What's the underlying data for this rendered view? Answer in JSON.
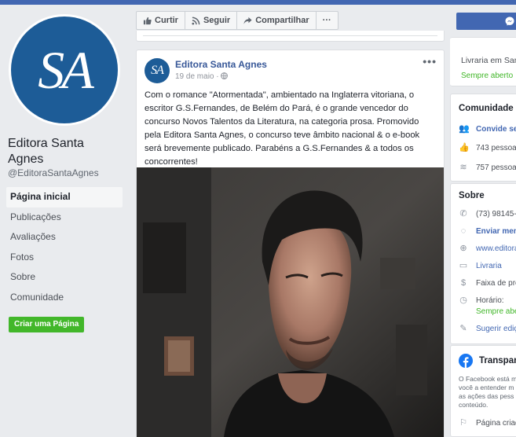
{
  "page": {
    "logo_text": "SA",
    "name": "Editora Santa Agnes",
    "handle": "@EditoraSantaAgnes"
  },
  "nav": {
    "items": [
      {
        "label": "Página inicial"
      },
      {
        "label": "Publicações"
      },
      {
        "label": "Avaliações"
      },
      {
        "label": "Fotos"
      },
      {
        "label": "Sobre"
      },
      {
        "label": "Comunidade"
      }
    ],
    "create_page": "Criar uma Página"
  },
  "actions": {
    "like": "Curtir",
    "follow": "Seguir",
    "share": "Compartilhar",
    "more": "···"
  },
  "post": {
    "author": "Editora Santa Agnes",
    "date": "19 de maio ·",
    "avatar_text": "SA",
    "more": "•••",
    "text": "Com o romance \"Atormentada\", ambientado na Inglaterra vitoriana, o escritor G.S.Fernandes, de Belém do Pará, é o grande vencedor do concurso Novos Talentos da Literatura, na categoria prosa. Promovido pela Editora Santa Agnes, o concurso teve âmbito nacional & o e-book será brevemente publicado. Parabéns a G.S.Fernandes & a todos os concorrentes!"
  },
  "right": {
    "category": "Livraria em San",
    "open": "Sempre aberto",
    "community_title": "Comunidade",
    "invite": "Convide se",
    "likes": "743 pessoa",
    "follows": "757 pessoa",
    "about_title": "Sobre",
    "phone": "(73) 98145-",
    "message": "Enviar men",
    "website": "www.editora",
    "category2": "Livraria",
    "price": "Faixa de pre",
    "hours_label": "Horário:",
    "hours_value": "Sempre abe",
    "suggest": "Sugerir ediç",
    "transp_title": "Transpar",
    "transp_l1": "O Facebook está m",
    "transp_l2": "você a entender m",
    "transp_l3": "as ações das pess",
    "transp_l4": "conteúdo.",
    "created": "Página criad"
  },
  "colors": {
    "fb_blue": "#4267b2",
    "logo_blue": "#1d5c97",
    "link_blue": "#385898",
    "green": "#42b72a"
  }
}
